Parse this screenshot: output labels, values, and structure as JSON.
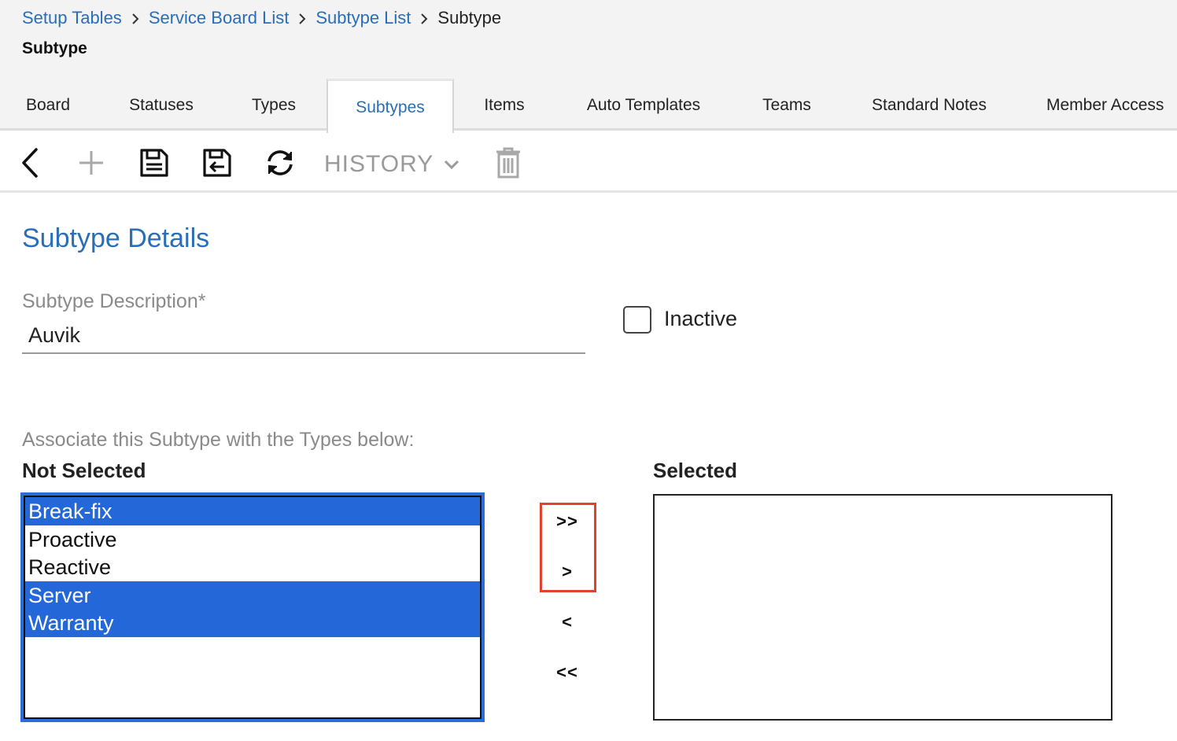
{
  "breadcrumb": {
    "items": [
      {
        "label": "Setup Tables"
      },
      {
        "label": "Service Board List"
      },
      {
        "label": "Subtype List"
      }
    ],
    "current": "Subtype"
  },
  "page_title": "Subtype",
  "tabs": [
    {
      "label": "Board"
    },
    {
      "label": "Statuses"
    },
    {
      "label": "Types"
    },
    {
      "label": "Subtypes",
      "active": true
    },
    {
      "label": "Items"
    },
    {
      "label": "Auto Templates"
    },
    {
      "label": "Teams"
    },
    {
      "label": "Standard Notes"
    },
    {
      "label": "Member Access"
    }
  ],
  "toolbar": {
    "icons": [
      "back-chevron-icon",
      "add-plus-icon",
      "save-icon",
      "save-and-close-icon",
      "refresh-icon",
      "trash-icon"
    ],
    "history_label": "HISTORY"
  },
  "form": {
    "section_title": "Subtype Details",
    "description_label": "Subtype Description*",
    "description_value": "Auvik",
    "inactive_label": "Inactive",
    "inactive_checked": false
  },
  "association": {
    "label": "Associate this Subtype with the Types below:",
    "not_selected_title": "Not Selected",
    "selected_title": "Selected",
    "not_selected_items": [
      {
        "label": "Break-fix",
        "highlighted": true
      },
      {
        "label": "Proactive",
        "highlighted": false
      },
      {
        "label": "Reactive",
        "highlighted": false
      },
      {
        "label": "Server",
        "highlighted": true
      },
      {
        "label": "Warranty",
        "highlighted": true
      }
    ],
    "selected_items": [],
    "buttons": {
      "move_all_right": ">>",
      "move_right": ">",
      "move_left": "<",
      "move_all_left": "<<"
    }
  },
  "colors": {
    "link": "#2a6db8",
    "selection": "#2467d8",
    "annotation": "#e2412f"
  }
}
